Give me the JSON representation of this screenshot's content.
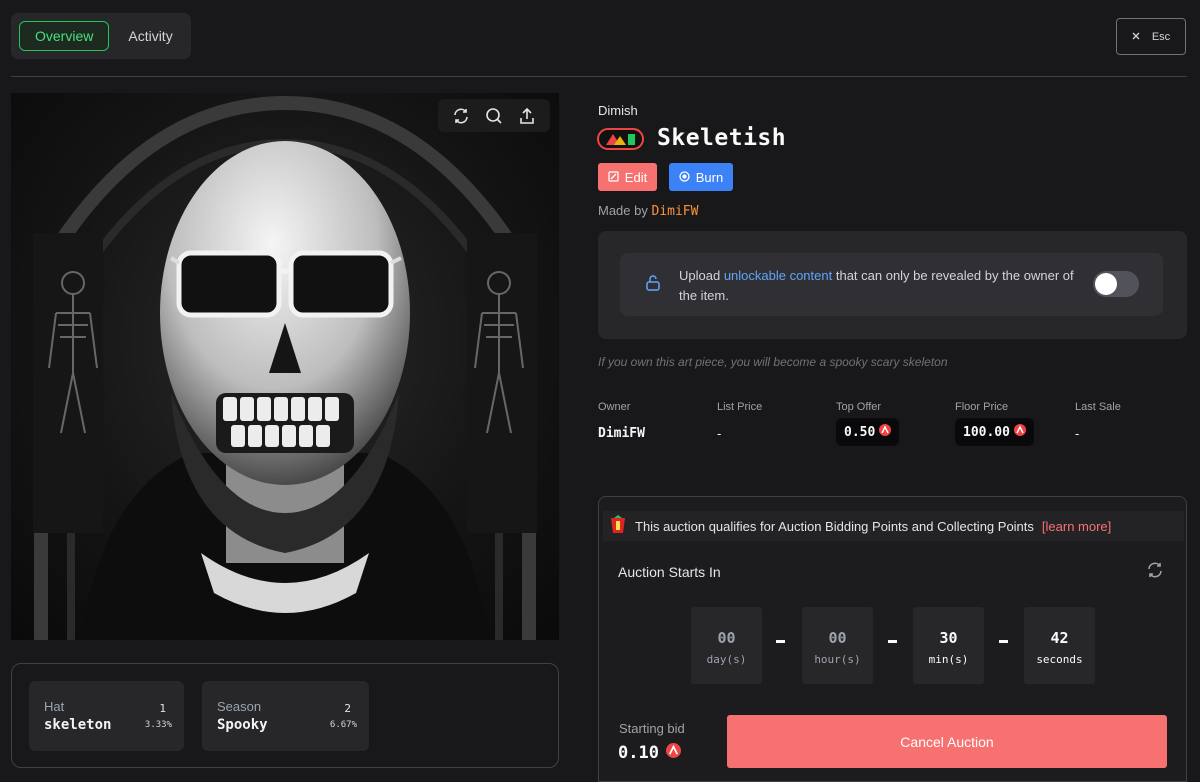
{
  "tabs": [
    {
      "label": "Overview",
      "active": true
    },
    {
      "label": "Activity",
      "active": false
    }
  ],
  "esc": {
    "icon": "close-icon",
    "label": "Esc"
  },
  "art_toolbar": [
    "refresh-icon",
    "zoom-icon",
    "share-icon"
  ],
  "item": {
    "collection": "Dimish",
    "title": "Skeletish",
    "edit_label": "Edit",
    "burn_label": "Burn",
    "made_by_label": "Made by",
    "creator": "DimiFW",
    "description": "If you own this art piece, you will become a spooky scary skeleton"
  },
  "unlockable": {
    "text_before": "Upload ",
    "link": "unlockable content",
    "text_after": " that can only be revealed by the owner of the item.",
    "enabled": false
  },
  "stats": {
    "owner_label": "Owner",
    "owner": "DimiFW",
    "list_price_label": "List Price",
    "list_price": "-",
    "top_offer_label": "Top Offer",
    "top_offer": "0.50",
    "floor_price_label": "Floor Price",
    "floor_price": "100.00",
    "last_sale_label": "Last Sale",
    "last_sale": "-"
  },
  "attributes": [
    {
      "trait": "Hat",
      "value": "skeleton",
      "count": "1",
      "percent": "3.33%"
    },
    {
      "trait": "Season",
      "value": "Spooky",
      "count": "2",
      "percent": "6.67%"
    }
  ],
  "auction": {
    "banner": "This auction qualifies for Auction Bidding Points and Collecting Points",
    "learn_more": "[learn more]",
    "heading": "Auction Starts In",
    "countdown": [
      {
        "value": "00",
        "unit": "day(s)"
      },
      {
        "value": "00",
        "unit": "hour(s)"
      },
      {
        "value": "30",
        "unit": "min(s)"
      },
      {
        "value": "42",
        "unit": "seconds"
      }
    ],
    "starting_bid_label": "Starting bid",
    "starting_bid": "0.10",
    "cancel_label": "Cancel Auction"
  },
  "colors": {
    "accent_green": "#22c55e",
    "danger": "#f87171",
    "primary_blue": "#3b82f6",
    "creator_orange": "#fb923c",
    "currency_red": "#ef4444"
  }
}
